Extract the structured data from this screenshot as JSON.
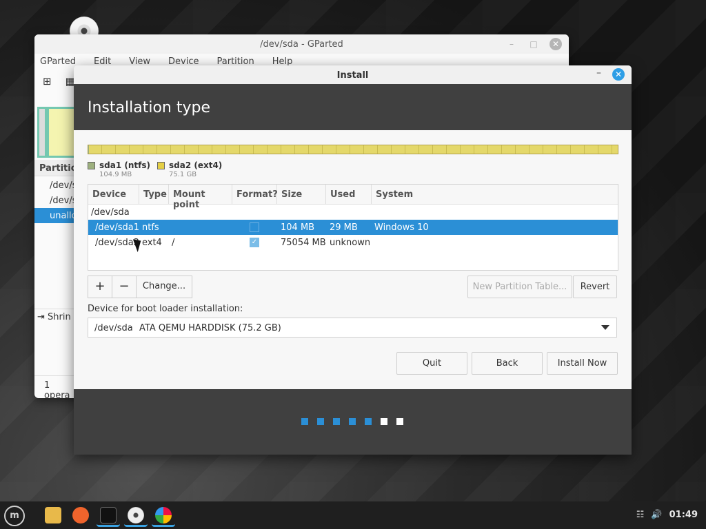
{
  "gparted": {
    "title": "/dev/sda - GParted",
    "menu": [
      "GParted",
      "Edit",
      "View",
      "Device",
      "Partition",
      "Help"
    ],
    "list_header": "Partitio",
    "rows": [
      "/dev/s",
      "/dev/s",
      "unallo"
    ],
    "pending_op": "Shrin",
    "status": "1 opera"
  },
  "install": {
    "title": "Install",
    "heading": "Installation type",
    "legend": [
      {
        "name": "sda1 (ntfs)",
        "size": "104.9 MB",
        "color": "#9db07e"
      },
      {
        "name": "sda2 (ext4)",
        "size": "75.1 GB",
        "color": "#e4cf45"
      }
    ],
    "table": {
      "columns": [
        "Device",
        "Type",
        "Mount point",
        "Format?",
        "Size",
        "Used",
        "System"
      ],
      "group": "/dev/sda",
      "rows": [
        {
          "device": "/dev/sda1",
          "type": "ntfs",
          "mount": "",
          "format": false,
          "size": "104 MB",
          "used": "29 MB",
          "system": "Windows 10",
          "selected": true
        },
        {
          "device": "/dev/sda2",
          "type": "ext4",
          "mount": "/",
          "format": true,
          "size": "75054 MB",
          "used": "unknown",
          "system": "",
          "selected": false
        }
      ]
    },
    "buttons": {
      "add": "+",
      "remove": "−",
      "change": "Change...",
      "new_table": "New Partition Table...",
      "revert": "Revert",
      "quit": "Quit",
      "back": "Back",
      "install_now": "Install Now"
    },
    "bootloader": {
      "label": "Device for boot loader installation:",
      "device": "/dev/sda",
      "description": "ATA QEMU HARDDISK (75.2 GB)"
    },
    "progress": {
      "total": 7,
      "completed": 5,
      "color_done": "#2b8fd6",
      "color_todo": "#ffffff"
    }
  },
  "taskbar": {
    "menu_icon": "mint-menu-icon",
    "apps": [
      "file-manager-icon",
      "firefox-icon",
      "terminal-icon",
      "install-disc-icon",
      "gparted-icon"
    ],
    "tray_icons": [
      "network-icon",
      "volume-icon"
    ],
    "time": "01:49"
  }
}
